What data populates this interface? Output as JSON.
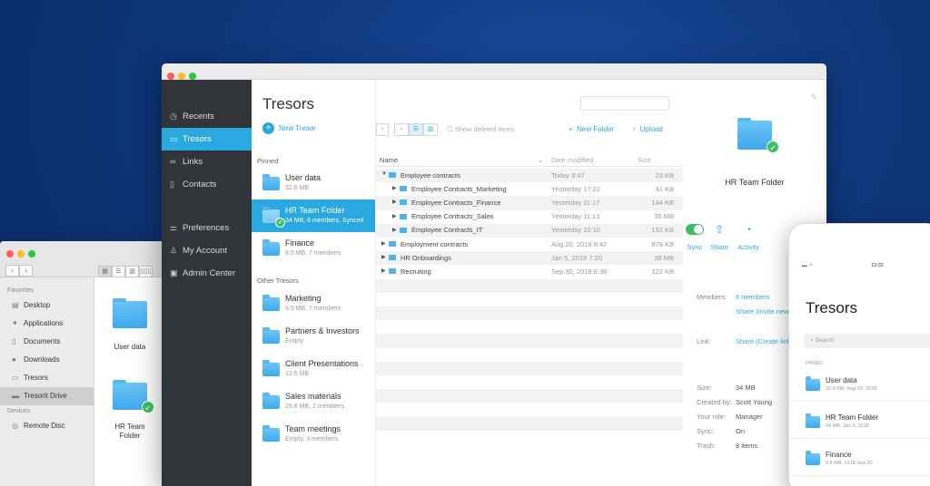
{
  "finder": {
    "view_icons": [
      "▦",
      "☰",
      "▥",
      "▯▯▯"
    ],
    "sidebar_favorites_header": "Favorites",
    "sidebar_items": [
      {
        "label": "Desktop",
        "icon": "desktop-icon"
      },
      {
        "label": "Applications",
        "icon": "applications-icon"
      },
      {
        "label": "Documents",
        "icon": "documents-icon"
      },
      {
        "label": "Downloads",
        "icon": "downloads-icon"
      },
      {
        "label": "Tresors",
        "icon": "tresors-folder-icon"
      },
      {
        "label": "Tresorit Drive",
        "icon": "drive-icon"
      }
    ],
    "sidebar_devices_header": "Devices",
    "device_items": [
      {
        "label": "Remote Disc",
        "icon": "disc-icon"
      }
    ],
    "folders": [
      {
        "label": "User data"
      },
      {
        "label": "HR Team\nFolder"
      }
    ]
  },
  "main": {
    "nav": [
      {
        "label": "Recents",
        "icon": "clock-icon"
      },
      {
        "label": "Tresors",
        "icon": "folder-icon"
      },
      {
        "label": "Links",
        "icon": "link-icon"
      },
      {
        "label": "Contacts",
        "icon": "contacts-icon"
      }
    ],
    "nav_bottom": [
      {
        "label": "Preferences",
        "icon": "sliders-icon"
      },
      {
        "label": "My Account",
        "icon": "user-icon"
      },
      {
        "label": "Admin Center",
        "icon": "admin-icon"
      }
    ],
    "title": "Tresors",
    "new_tresor": "New Tresor",
    "pinned_header": "Pinned",
    "pinned": [
      {
        "name": "User data",
        "meta": "32.6 MB"
      },
      {
        "name": "HR Team Folder",
        "meta": "34 MB, 6 members, Synced"
      },
      {
        "name": "Finance",
        "meta": "8.5 MB, 7 members"
      }
    ],
    "other_header": "Other Tresors",
    "others": [
      {
        "name": "Marketing",
        "meta": "9.5 MB, 7 members"
      },
      {
        "name": "Partners & Investors",
        "meta": "Empty"
      },
      {
        "name": "Client Presentations",
        "meta": "12.5 MB"
      },
      {
        "name": "Sales materials",
        "meta": "29.8 MB, 2 members"
      },
      {
        "name": "Team meetings",
        "meta": "Empty, 3 members"
      }
    ],
    "toolbar": {
      "show_deleted": "Show deleted items",
      "new_folder": "New Folder",
      "upload": "Upload"
    },
    "columns": {
      "name": "Name",
      "date": "Date modified",
      "size": "Size"
    },
    "files": [
      {
        "name": "Employee contracts",
        "date": "Today 8:47",
        "size": "23 KB",
        "level": 0,
        "expanded": true
      },
      {
        "name": "Employee Contracts_Marketing",
        "date": "Yesterday 17:22",
        "size": "41 KB",
        "level": 1
      },
      {
        "name": "Employee Contracts_Finance",
        "date": "Yesterday 11:17",
        "size": "144 KB",
        "level": 1
      },
      {
        "name": "Employee Contracts_Sales",
        "date": "Yesterday 11:13",
        "size": "35 MB",
        "level": 1
      },
      {
        "name": "Employee Contracts_IT",
        "date": "Yesterday 10:10",
        "size": "152 KB",
        "level": 1
      },
      {
        "name": "Employment contracts",
        "date": "Aug 20, 2018 8:42",
        "size": "879 KB",
        "level": 0
      },
      {
        "name": "HR Onboardings",
        "date": "Jan 5, 2018 7:20",
        "size": "38 MB",
        "level": 0
      },
      {
        "name": "Recruiting",
        "date": "Sep 30, 2018 6:38",
        "size": "122 KB",
        "level": 0
      }
    ],
    "details": {
      "title": "HR Team Folder",
      "sync_label": "Sync",
      "share_label": "Share",
      "activity_label": "Activity",
      "members_label": "Members:",
      "members_value": "6 members",
      "share_invite": "Share (Invite new",
      "link_label": "Link:",
      "link_value": "Share (Create link)",
      "size_label": "Size:",
      "size_value": "34 MB",
      "created_label": "Created by:",
      "created_value": "Scott Young",
      "role_label": "Your role:",
      "role_value": "Manager",
      "sync_status_label": "Sync:",
      "sync_status_value": "On",
      "trash_label": "Trash:",
      "trash_value": "8 items"
    }
  },
  "phone": {
    "time": "13:02",
    "title": "Tresors",
    "search_placeholder": "Search",
    "section": "PINNED",
    "items": [
      {
        "name": "User data",
        "meta": "32.6 MB, Aug 20, 2018"
      },
      {
        "name": "HR Team Folder",
        "meta": "34 MB, Jan 5, 2018"
      },
      {
        "name": "Finance",
        "meta": "8.5 MB, 2018 Sep 30"
      }
    ]
  },
  "colors": {
    "accent": "#2aa8e0",
    "nav_bg": "#31353a",
    "folder": "#4fb2ee",
    "sync_green": "#3ac262"
  }
}
